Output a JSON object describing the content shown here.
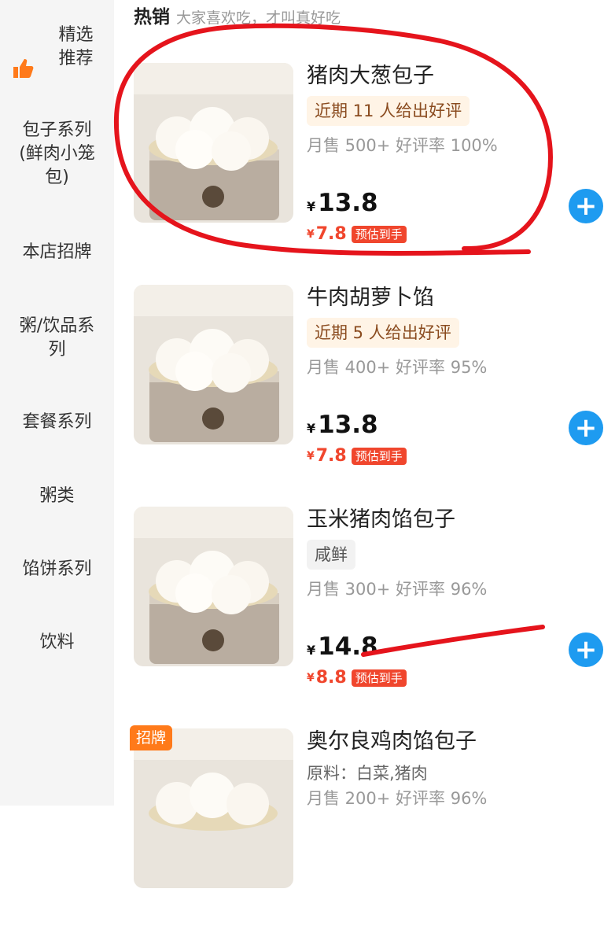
{
  "sidebar": {
    "items": [
      {
        "label": "精选\n推荐",
        "icon": "thumbs-up-icon"
      },
      {
        "label": "包子系列\n(鲜肉小笼\n包)"
      },
      {
        "label": "本店招牌"
      },
      {
        "label": "粥/饮品系\n列"
      },
      {
        "label": "套餐系列"
      },
      {
        "label": "粥类"
      },
      {
        "label": "馅饼系列"
      },
      {
        "label": "饮料"
      }
    ]
  },
  "section": {
    "title": "热销",
    "subtitle": "大家喜欢吃，才叫真好吃"
  },
  "currency": "¥",
  "products": [
    {
      "name": "猪肉大葱包子",
      "tag": "近期 11 人给出好评",
      "tag_type": "review",
      "stats": "月售 500+ 好评率 100%",
      "price": "13.8",
      "est_price": "7.8",
      "est_label": "预估到手"
    },
    {
      "name": "牛肉胡萝卜馅",
      "tag": "近期 5 人给出好评",
      "tag_type": "review",
      "stats": "月售 400+ 好评率 95%",
      "price": "13.8",
      "est_price": "7.8",
      "est_label": "预估到手"
    },
    {
      "name": "玉米猪肉馅包子",
      "tag": "咸鲜",
      "tag_type": "flavor",
      "stats": "月售 300+ 好评率 96%",
      "price": "14.8",
      "est_price": "8.8",
      "est_label": "预估到手"
    },
    {
      "name": "奥尔良鸡肉馅包子",
      "badge": "招牌",
      "ingredients": "原料：白菜,猪肉",
      "stats": "月售 200+ 好评率 96%"
    }
  ],
  "add_button_symbol": "+",
  "colors": {
    "accent_blue": "#1e9bf0",
    "price_red": "#f0462d",
    "badge_orange": "#ff7a1a",
    "annotation_red": "#e5141c"
  }
}
